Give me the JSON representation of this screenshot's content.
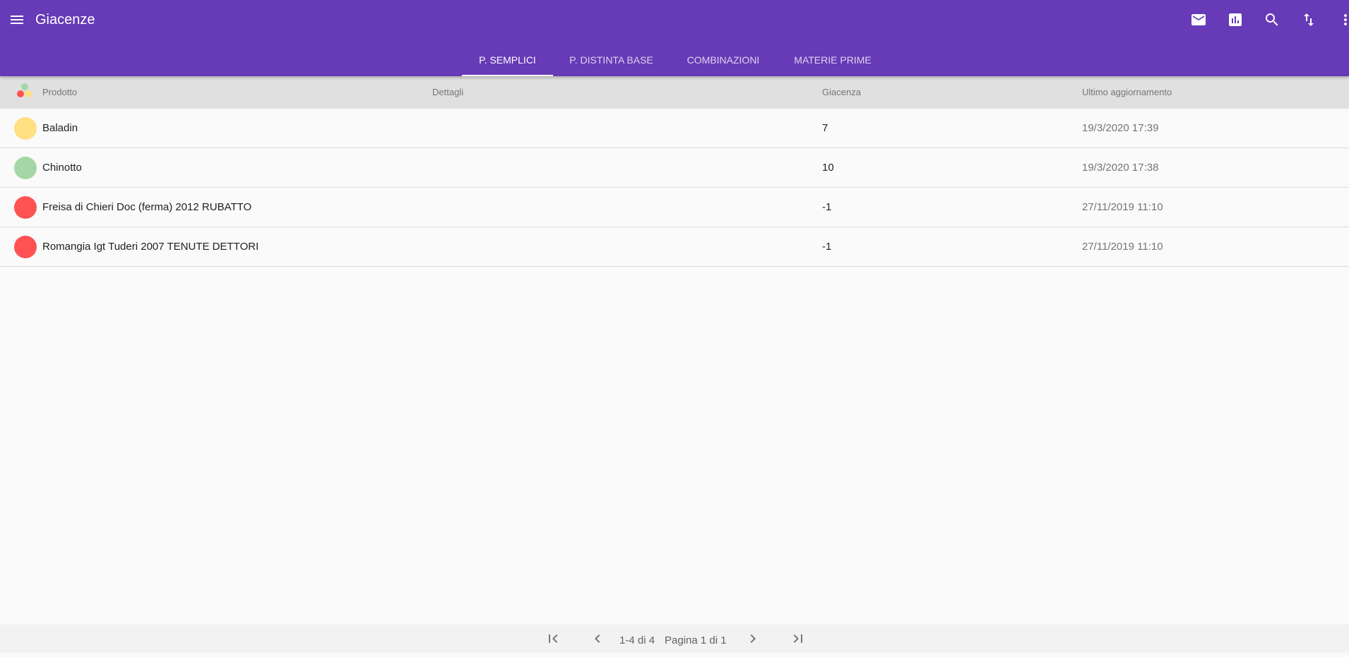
{
  "appbar": {
    "title": "Giacenze",
    "color": "#673ab7",
    "actions": [
      "mail-icon",
      "bar-chart-icon",
      "search-icon",
      "sort-icon",
      "more-vert-icon"
    ]
  },
  "tabs": [
    {
      "label": "P. SEMPLICI",
      "active": true
    },
    {
      "label": "P. DISTINTA BASE",
      "active": false
    },
    {
      "label": "COMBINAZIONI",
      "active": false
    },
    {
      "label": "MATERIE PRIME",
      "active": false
    }
  ],
  "table": {
    "headers": {
      "product": "Prodotto",
      "details": "Dettagli",
      "stock": "Giacenza",
      "updated": "Ultimo aggiornamento"
    },
    "status_colors": {
      "green": "#a5d6a7",
      "yellow": "#ffe082",
      "red": "#ff5252"
    },
    "rows": [
      {
        "status": "yellow",
        "product": "Baladin",
        "details": "",
        "stock": "7",
        "updated": "19/3/2020 17:39"
      },
      {
        "status": "green",
        "product": "Chinotto",
        "details": "",
        "stock": "10",
        "updated": "19/3/2020 17:38"
      },
      {
        "status": "red",
        "product": "Freisa di Chieri Doc (ferma) 2012 RUBATTO",
        "details": "",
        "stock": "-1",
        "updated": "27/11/2019 11:10"
      },
      {
        "status": "red",
        "product": "Romangia Igt Tuderi 2007 TENUTE DETTORI",
        "details": "",
        "stock": "-1",
        "updated": "27/11/2019 11:10"
      }
    ]
  },
  "pagination": {
    "range": "1-4 di 4",
    "page": "Pagina 1 di 1"
  }
}
